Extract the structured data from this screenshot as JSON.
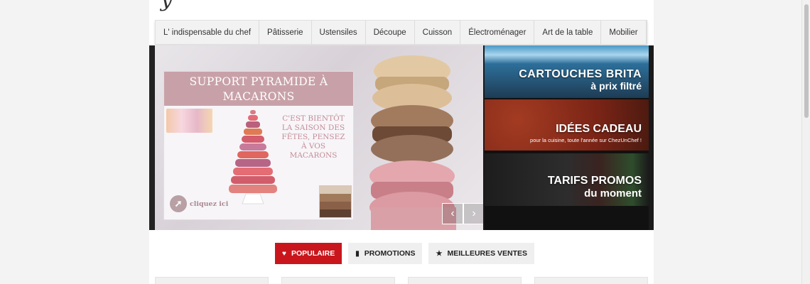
{
  "nav": {
    "items": [
      {
        "label": "L' indispensable du chef"
      },
      {
        "label": "Pâtisserie"
      },
      {
        "label": "Ustensiles"
      },
      {
        "label": "Découpe"
      },
      {
        "label": "Cuisson"
      },
      {
        "label": "Électroménager"
      },
      {
        "label": "Art de la table"
      },
      {
        "label": "Mobilier"
      }
    ]
  },
  "slide": {
    "promo_title": "SUPPORT PYRAMIDE À MACARONS",
    "promo_text": "C'EST BIENTÔT LA SAISON DES FÊTES, PENSEZ À VOS MACARONS",
    "promo_link": "cliquez ici"
  },
  "banners": [
    {
      "title": "CARTOUCHES BRITA",
      "subtitle": "à prix filtré"
    },
    {
      "title": "IDÉES CADEAU",
      "subtitle": "pour la cuisine, toute l'année sur ChezUnChef !"
    },
    {
      "title": "TARIFS PROMOS",
      "subtitle": "du moment"
    }
  ],
  "tabs": [
    {
      "label": "POPULAIRE",
      "icon": "heart-icon",
      "active": true
    },
    {
      "label": "PROMOTIONS",
      "icon": "bookmark-icon",
      "active": false
    },
    {
      "label": "MEILLEURES VENTES",
      "icon": "star-icon",
      "active": false
    }
  ],
  "colors": {
    "accent": "#c9161c",
    "promo_pink": "#c8a1a8"
  }
}
